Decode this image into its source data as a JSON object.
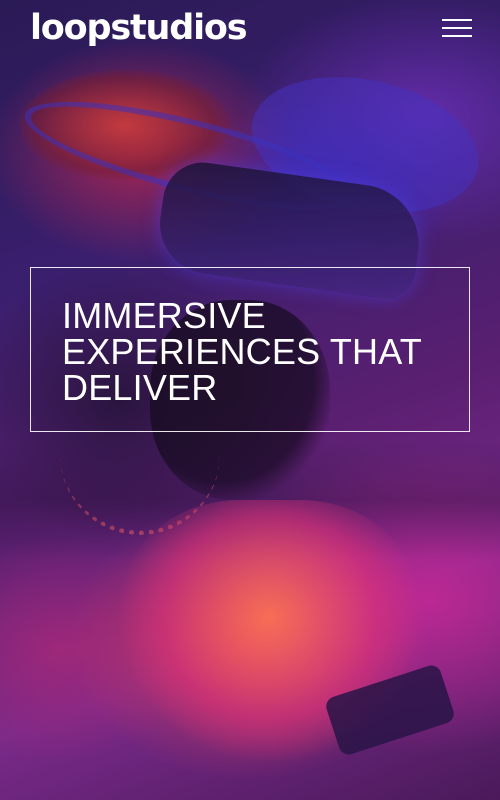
{
  "brand": {
    "logo_text": "loopstudios"
  },
  "header": {
    "menu_icon": "hamburger-menu-icon"
  },
  "hero": {
    "headline_lines": [
      "IMMERSIVE",
      "EXPERIENCES THAT",
      "DELIVER"
    ],
    "background_image": "person-wearing-vr-headset-photo"
  },
  "colors": {
    "text": "#ffffff",
    "overlay_purple": "#5a1f70",
    "overlay_magenta": "#c8288c"
  }
}
